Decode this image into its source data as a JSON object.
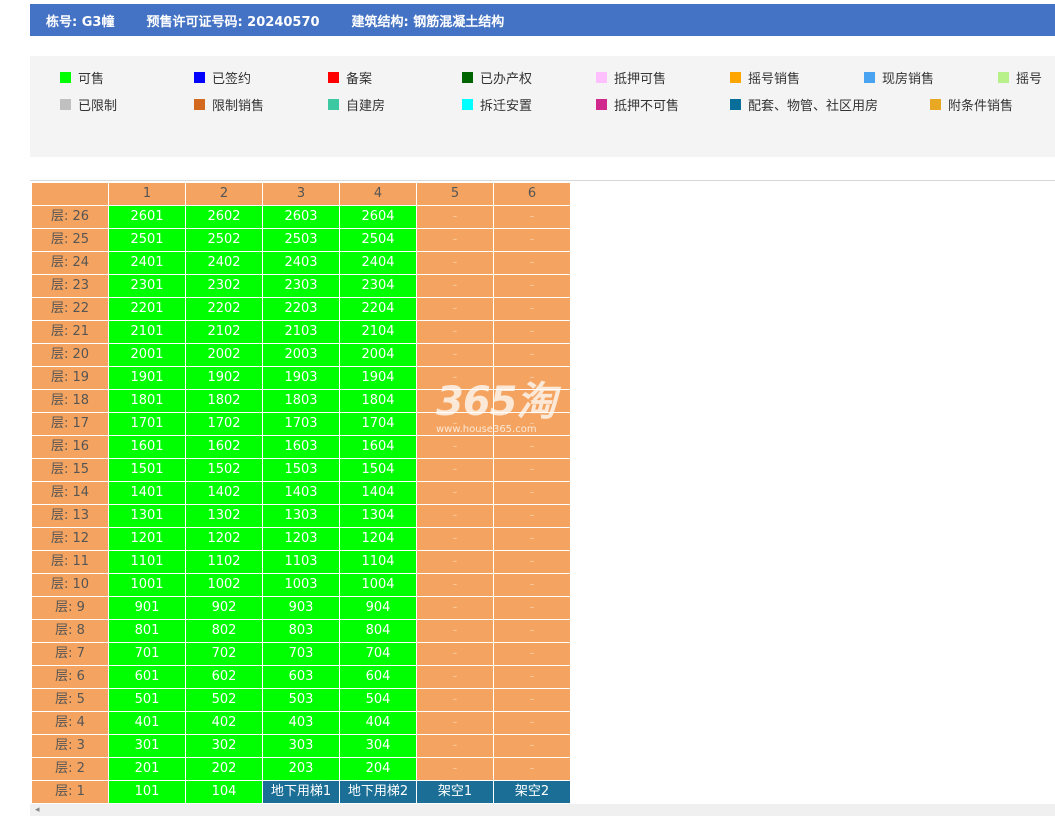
{
  "header": {
    "building": "栋号: G3幢",
    "permit": "预售许可证号码: 20240570",
    "structure": "建筑结构: 钢筋混凝土结构"
  },
  "legend": [
    {
      "label": "可售",
      "color": "#00ff00"
    },
    {
      "label": "已签约",
      "color": "#0000ff"
    },
    {
      "label": "备案",
      "color": "#ff0000"
    },
    {
      "label": "已办产权",
      "color": "#006400"
    },
    {
      "label": "抵押可售",
      "color": "#ffc0ff"
    },
    {
      "label": "摇号销售",
      "color": "#ffa500"
    },
    {
      "label": "现房销售",
      "color": "#4aa3f0"
    },
    {
      "label": "摇号",
      "color": "#b8f08a"
    },
    {
      "label": "已限制",
      "color": "#c0c0c0"
    },
    {
      "label": "限制销售",
      "color": "#d2691e"
    },
    {
      "label": "自建房",
      "color": "#3cc8a0"
    },
    {
      "label": "拆迁安置",
      "color": "#00ffff"
    },
    {
      "label": "抵押不可售",
      "color": "#d0288c"
    },
    {
      "label": "配套、物管、社区用房",
      "color": "#0a6e9a"
    },
    {
      "label": "附条件销售",
      "color": "#e8a824"
    }
  ],
  "table": {
    "columns": [
      "1",
      "2",
      "3",
      "4",
      "5",
      "6"
    ],
    "rows": [
      {
        "floor": "层: 26",
        "units": [
          "2601",
          "2602",
          "2603",
          "2604",
          "-",
          "-"
        ]
      },
      {
        "floor": "层: 25",
        "units": [
          "2501",
          "2502",
          "2503",
          "2504",
          "-",
          "-"
        ]
      },
      {
        "floor": "层: 24",
        "units": [
          "2401",
          "2402",
          "2403",
          "2404",
          "-",
          "-"
        ]
      },
      {
        "floor": "层: 23",
        "units": [
          "2301",
          "2302",
          "2303",
          "2304",
          "-",
          "-"
        ]
      },
      {
        "floor": "层: 22",
        "units": [
          "2201",
          "2202",
          "2203",
          "2204",
          "-",
          "-"
        ]
      },
      {
        "floor": "层: 21",
        "units": [
          "2101",
          "2102",
          "2103",
          "2104",
          "-",
          "-"
        ]
      },
      {
        "floor": "层: 20",
        "units": [
          "2001",
          "2002",
          "2003",
          "2004",
          "-",
          "-"
        ]
      },
      {
        "floor": "层: 19",
        "units": [
          "1901",
          "1902",
          "1903",
          "1904",
          "-",
          "-"
        ]
      },
      {
        "floor": "层: 18",
        "units": [
          "1801",
          "1802",
          "1803",
          "1804",
          "-",
          "-"
        ]
      },
      {
        "floor": "层: 17",
        "units": [
          "1701",
          "1702",
          "1703",
          "1704",
          "-",
          "-"
        ]
      },
      {
        "floor": "层: 16",
        "units": [
          "1601",
          "1602",
          "1603",
          "1604",
          "-",
          "-"
        ]
      },
      {
        "floor": "层: 15",
        "units": [
          "1501",
          "1502",
          "1503",
          "1504",
          "-",
          "-"
        ]
      },
      {
        "floor": "层: 14",
        "units": [
          "1401",
          "1402",
          "1403",
          "1404",
          "-",
          "-"
        ]
      },
      {
        "floor": "层: 13",
        "units": [
          "1301",
          "1302",
          "1303",
          "1304",
          "-",
          "-"
        ]
      },
      {
        "floor": "层: 12",
        "units": [
          "1201",
          "1202",
          "1203",
          "1204",
          "-",
          "-"
        ]
      },
      {
        "floor": "层: 11",
        "units": [
          "1101",
          "1102",
          "1103",
          "1104",
          "-",
          "-"
        ]
      },
      {
        "floor": "层: 10",
        "units": [
          "1001",
          "1002",
          "1003",
          "1004",
          "-",
          "-"
        ]
      },
      {
        "floor": "层: 9",
        "units": [
          "901",
          "902",
          "903",
          "904",
          "-",
          "-"
        ]
      },
      {
        "floor": "层: 8",
        "units": [
          "801",
          "802",
          "803",
          "804",
          "-",
          "-"
        ]
      },
      {
        "floor": "层: 7",
        "units": [
          "701",
          "702",
          "703",
          "704",
          "-",
          "-"
        ]
      },
      {
        "floor": "层: 6",
        "units": [
          "601",
          "602",
          "603",
          "604",
          "-",
          "-"
        ]
      },
      {
        "floor": "层: 5",
        "units": [
          "501",
          "502",
          "503",
          "504",
          "-",
          "-"
        ]
      },
      {
        "floor": "层: 4",
        "units": [
          "401",
          "402",
          "403",
          "404",
          "-",
          "-"
        ]
      },
      {
        "floor": "层: 3",
        "units": [
          "301",
          "302",
          "303",
          "304",
          "-",
          "-"
        ]
      },
      {
        "floor": "层: 2",
        "units": [
          "201",
          "202",
          "203",
          "204",
          "-",
          "-"
        ]
      },
      {
        "floor": "层: 1",
        "units": [
          "101",
          "104",
          "地下用梯1",
          "地下用梯2",
          "架空1",
          "架空2"
        ]
      }
    ]
  },
  "watermark": {
    "logo": "365淘",
    "site": "www.house365.com"
  },
  "scrollbar": {
    "left_arrow": "◂"
  },
  "colors": {
    "available": "#00ff00",
    "empty": "#f4a460",
    "special": "#1b6f96",
    "header": "#4472c4"
  }
}
